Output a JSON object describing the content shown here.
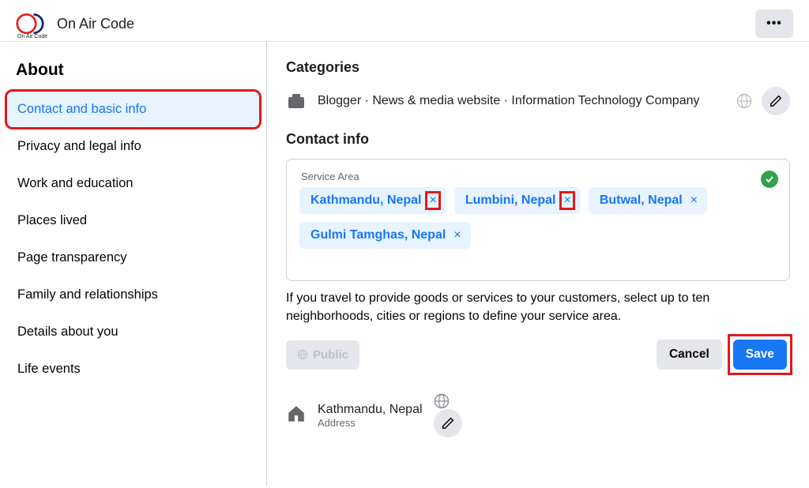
{
  "header": {
    "page_name": "On Air Code",
    "logo_sub": "On Air Code",
    "more": "•••"
  },
  "sidebar": {
    "title": "About",
    "items": [
      {
        "label": "Contact and basic info",
        "active": true
      },
      {
        "label": "Privacy and legal info"
      },
      {
        "label": "Work and education"
      },
      {
        "label": "Places lived"
      },
      {
        "label": "Page transparency"
      },
      {
        "label": "Family and relationships"
      },
      {
        "label": "Details about you"
      },
      {
        "label": "Life events"
      }
    ]
  },
  "main": {
    "categories_heading": "Categories",
    "categories_text": "Blogger · News & media website · Information Technology Company",
    "contact_heading": "Contact info",
    "service_area_label": "Service Area",
    "service_area_chips": [
      "Kathmandu, Nepal",
      "Lumbini, Nepal",
      "Butwal, Nepal",
      "Gulmi Tamghas, Nepal"
    ],
    "chip_remove": "×",
    "hint_text": "If you travel to provide goods or services to your customers, select up to ten neighborhoods, cities or regions to define your service area.",
    "visibility": "Public",
    "cancel_label": "Cancel",
    "save_label": "Save",
    "address_value": "Kathmandu, Nepal",
    "address_label": "Address"
  }
}
